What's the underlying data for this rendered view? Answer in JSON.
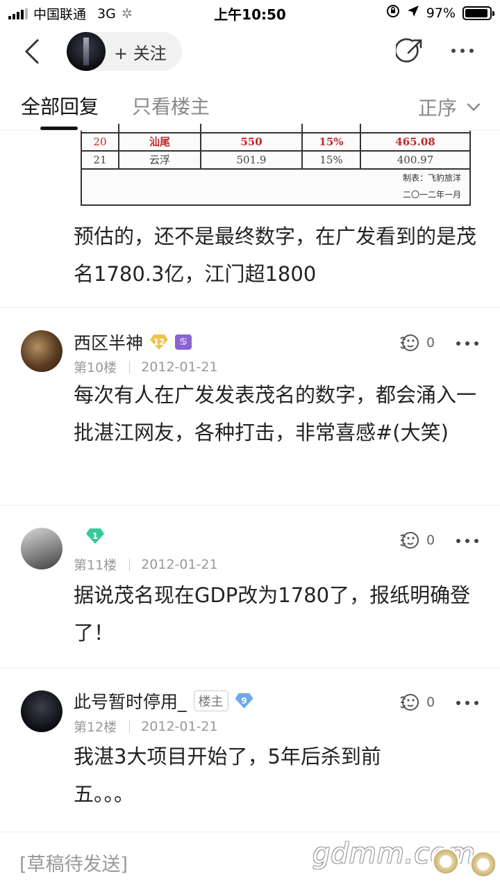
{
  "status_bar": {
    "carrier": "中国联通",
    "network": "3G",
    "time": "上午10:50",
    "battery": "97%",
    "battery_level": 0.97
  },
  "nav": {
    "follow_label": "+ 关注"
  },
  "tabs": {
    "all": "全部回复",
    "owner_only": "只看楼主",
    "order": "正序"
  },
  "table": {
    "rows": [
      {
        "no": "20",
        "city": "汕尾",
        "value": "550",
        "rate": "15%",
        "result": "465.08"
      },
      {
        "no": "21",
        "city": "云浮",
        "value": "501.9",
        "rate": "15%",
        "result": "400.97"
      }
    ],
    "footer_1": "制表：飞豹旅洋",
    "footer_2": "二〇一二年一月"
  },
  "top_text": "预估的，还不是最终数字，在广发看到的是茂名1780.3亿，江门超1800",
  "posts": [
    {
      "username": "西区半神",
      "level": "12",
      "floor": "第10楼",
      "date": "2012-01-21",
      "likes": "0",
      "text": "每次有人在广发发表茂名的数字，都会涌入一批湛江网友，各种打击，非常喜感#(大笑)"
    },
    {
      "username": "",
      "level": "1",
      "floor": "第11楼",
      "date": "2012-01-21",
      "likes": "0",
      "text": "据说茂名现在GDP改为1780了，报纸明确登了！"
    },
    {
      "username": "此号暂时停用_",
      "owner_tag": "楼主",
      "level": "9",
      "floor": "第12楼",
      "date": "2012-01-21",
      "likes": "0",
      "text": "我湛3大项目开始了，5年后杀到前五。。。"
    }
  ],
  "bottom": {
    "draft": "[草稿待发送]",
    "watermark": "gdmm.com"
  }
}
